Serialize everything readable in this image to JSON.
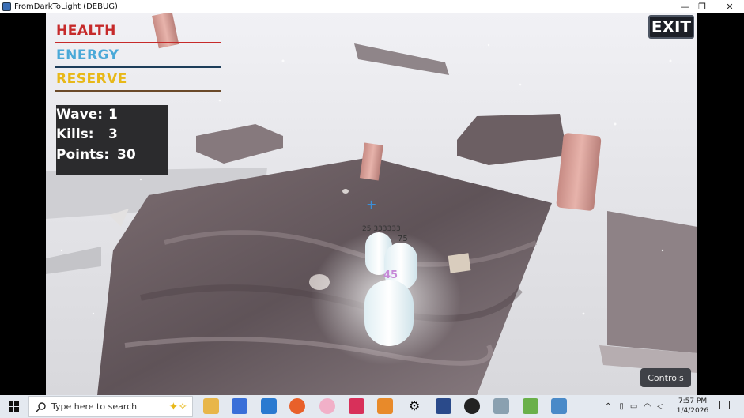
{
  "window": {
    "title": "FromDarkToLight (DEBUG)",
    "minimize_glyph": "—",
    "restore_glyph": "❐",
    "close_glyph": "✕"
  },
  "hud": {
    "health_label": "HEALTH",
    "energy_label": "ENERGY",
    "reserve_label": "RESERVE",
    "health_color": "#c62a2a",
    "energy_color": "#4aa9d8",
    "reserve_color": "#e8b818",
    "wave_label": "Wave:",
    "wave_value": "1",
    "kills_label": "Kills:",
    "kills_value": "3",
    "points_label": "Points:",
    "points_value": "30",
    "exit_label": "EXIT",
    "controls_label": "Controls",
    "crosshair_glyph": "+"
  },
  "scene": {
    "floating_number_1": "75",
    "floating_number_2": "45",
    "floating_text": "25 333333"
  },
  "taskbar": {
    "search_placeholder": "Type here to search",
    "time": "7:57 PM",
    "date": "1/4/2026",
    "icons": [
      "file-explorer-icon",
      "store-icon",
      "outlook-icon",
      "firefox-icon",
      "paint-icon",
      "jetbrains-icon",
      "app-icon",
      "settings-icon",
      "visual-studio-icon",
      "unity-icon",
      "task-manager-icon",
      "app2-icon",
      "godot-icon"
    ]
  }
}
